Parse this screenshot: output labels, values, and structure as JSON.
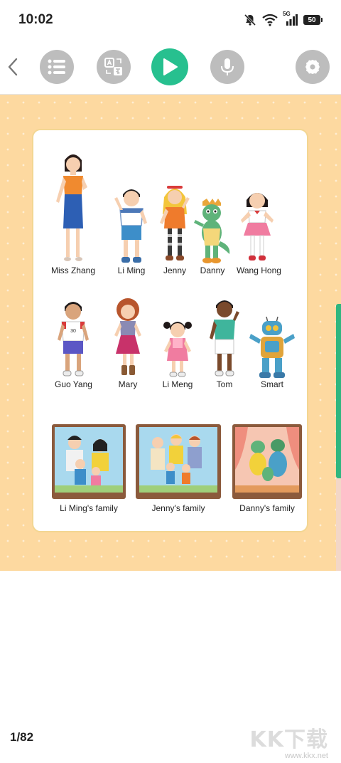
{
  "status_bar": {
    "time": "10:02",
    "network": "5G",
    "battery": "50"
  },
  "toolbar": {
    "buttons": [
      {
        "name": "back",
        "icon": "chevron-left-icon"
      },
      {
        "name": "catalog",
        "icon": "list-icon"
      },
      {
        "name": "translate",
        "icon": "translate-icon"
      },
      {
        "name": "play",
        "icon": "play-icon",
        "color": "#27c08f"
      },
      {
        "name": "record",
        "icon": "microphone-icon"
      },
      {
        "name": "settings",
        "icon": "gear-icon"
      }
    ]
  },
  "page": {
    "characters": [
      {
        "label": "Miss Zhang"
      },
      {
        "label": "Li Ming"
      },
      {
        "label": "Jenny"
      },
      {
        "label": "Danny"
      },
      {
        "label": "Wang Hong"
      },
      {
        "label": "Guo Yang"
      },
      {
        "label": "Mary"
      },
      {
        "label": "Li Meng"
      },
      {
        "label": "Tom"
      },
      {
        "label": "Smart"
      }
    ],
    "jersey_number": "30",
    "families": [
      {
        "label": "Li Ming's family"
      },
      {
        "label": "Jenny's family"
      },
      {
        "label": "Danny's family"
      }
    ],
    "background_color": "#fdd9a0",
    "accent_color": "#27c08f"
  },
  "footer": {
    "page_indicator": "1/82",
    "watermark_logo": "KK下载",
    "watermark_url": "www.kkx.net"
  }
}
